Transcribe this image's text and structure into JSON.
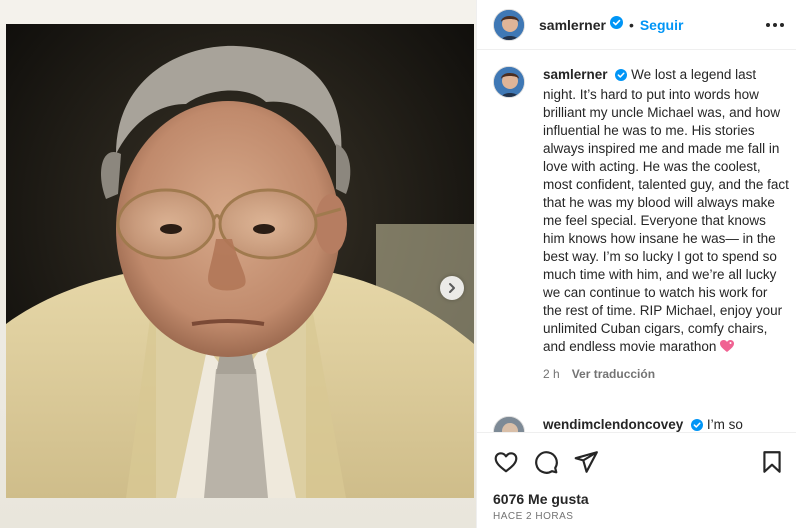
{
  "post": {
    "username": "samlerner",
    "separator": "•",
    "follow_label": "Seguir",
    "carousel": {
      "has_next": true
    }
  },
  "caption": {
    "username": "samlerner",
    "text": "We lost a legend last night. It’s hard to put into words how brilliant my uncle Michael was, and how influential he was to me. His stories always inspired me and made me fall in love with acting. He was the coolest, most confident, talented guy, and the fact that he was my blood will always make me feel special. Everyone that knows him knows how insane he was— in the best way. I’m so lucky I got to spend so much time with him, and we’re all lucky we can continue to watch his work for the rest of time. RIP Michael, enjoy your unlimited Cuban cigars, comfy chairs, and endless movie marathon",
    "emoji": "sparkling-heart",
    "age": "2 h",
    "translate_label": "Ver traducción"
  },
  "next_comment": {
    "username": "wendimclendoncovey",
    "text": "I’m so"
  },
  "footer": {
    "likes": "6076 Me gusta",
    "timestamp": "HACE 2 HORAS"
  },
  "icons": {
    "more": "more-options-icon",
    "like": "heart-outline-icon",
    "comment": "comment-icon",
    "share": "share-paper-plane-icon",
    "save": "bookmark-icon",
    "verified": "verified-badge-icon",
    "next": "chevron-right-icon"
  },
  "colors": {
    "accent": "#0095f6",
    "verified": "#0095f6",
    "text": "#262626",
    "muted": "#737373",
    "emoji_heart": "#f06292"
  }
}
